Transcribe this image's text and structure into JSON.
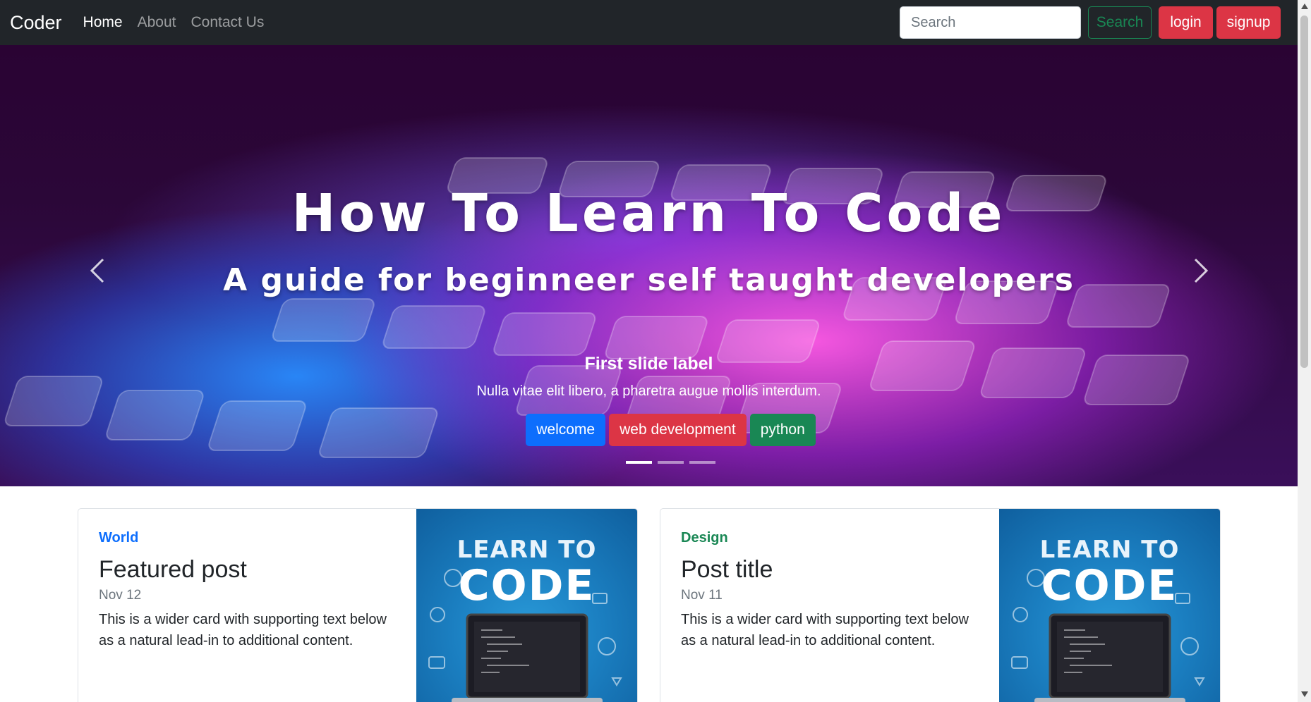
{
  "navbar": {
    "brand": "Coder",
    "links": [
      "Home",
      "About",
      "Contact Us"
    ],
    "search_placeholder": "Search",
    "search_button": "Search",
    "login_button": "login",
    "signup_button": "signup"
  },
  "carousel": {
    "image_title": "How To Learn To Code",
    "image_subtitle": "A guide for beginneer self taught developers",
    "caption_title": "First slide label",
    "caption_text": "Nulla vitae elit libero, a pharetra augue mollis interdum.",
    "tags": [
      "welcome",
      "web development",
      "python"
    ],
    "slide_count": 3,
    "active_slide": 1
  },
  "cards": [
    {
      "category": "World",
      "title": "Featured post",
      "date": "Nov 12",
      "text": "This is a wider card with supporting text below as a natural lead-in to additional content.",
      "image_text_top": "LEARN TO",
      "image_text_bottom": "CODE"
    },
    {
      "category": "Design",
      "title": "Post title",
      "date": "Nov 11",
      "text": "This is a wider card with supporting text below as a natural lead-in to additional content.",
      "image_text_top": "LEARN TO",
      "image_text_bottom": "CODE"
    }
  ],
  "colors": {
    "navbar_bg": "#212529",
    "primary": "#0d6efd",
    "danger": "#dc3545",
    "success": "#198754"
  },
  "icons": [
    "chevron-left-icon",
    "chevron-right-icon",
    "scroll-up-icon",
    "scroll-down-icon"
  ]
}
